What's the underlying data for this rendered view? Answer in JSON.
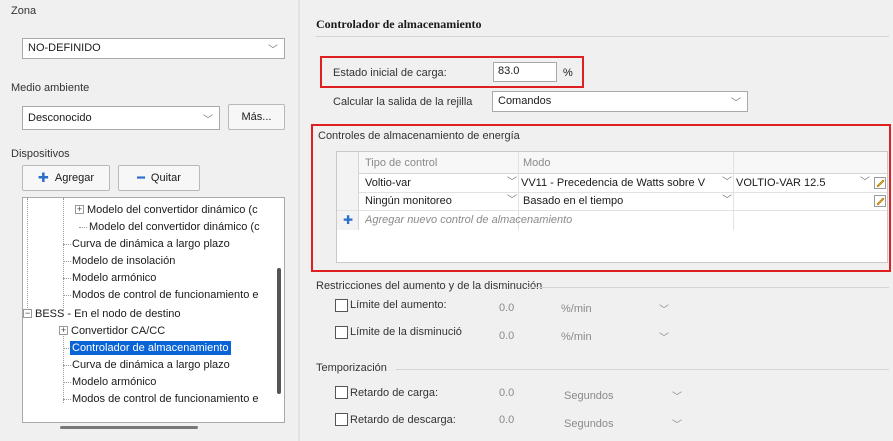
{
  "left": {
    "zone_label": "Zona",
    "zone_value": "NO-DEFINIDO",
    "env_label": "Medio ambiente",
    "env_value": "Desconocido",
    "more_button": "Más...",
    "devices_label": "Dispositivos",
    "add_button": "Agregar",
    "remove_button": "Quitar",
    "tree": [
      "Modelo del convertidor dinámico (c",
      "Modelo del convertidor dinámico (c",
      "Curva de dinámica a largo plazo",
      "Modelo de insolación",
      "Modelo armónico",
      "Modos de control de funcionamiento e",
      "BESS - En el nodo de destino",
      "Convertidor CA/CC",
      "Controlador de almacenamiento",
      "Curva de dinámica a largo plazo",
      "Modelo armónico",
      "Modos de control de funcionamiento e"
    ]
  },
  "main": {
    "title": "Controlador de almacenamiento",
    "soc_label": "Estado inicial de carga:",
    "soc_value": "83.0",
    "soc_unit": "%",
    "grid_output_label": "Calcular la salida de la rejilla",
    "grid_output_value": "Comandos"
  },
  "ctrl": {
    "title": "Controles de almacenamiento de energía",
    "headers": [
      "Tipo de control",
      "Modo"
    ],
    "rows": [
      {
        "type": "Voltio-var",
        "mode": "VV11 - Precedencia de Watts sobre V",
        "value": "VOLTIO-VAR 12.5"
      },
      {
        "type": "Ningún monitoreo",
        "mode": "Basado en el tiempo",
        "value": ""
      }
    ],
    "add_row": "Agregar nuevo control de almacenamiento"
  },
  "ramp": {
    "title": "Restricciones del aumento y de la disminución",
    "up_label": "Límite del aumento:",
    "up_value": "0.0",
    "up_unit": "%/min",
    "down_label": "Límite de la disminució",
    "down_value": "0.0",
    "down_unit": "%/min"
  },
  "timing": {
    "title": "Temporización",
    "charge_label": "Retardo de carga:",
    "charge_value": "0.0",
    "charge_unit": "Segundos",
    "discharge_label": "Retardo de descarga:",
    "discharge_value": "0.0",
    "discharge_unit": "Segundos"
  },
  "colors": {
    "highlight": "#e02020",
    "selection": "#0a64d6"
  }
}
